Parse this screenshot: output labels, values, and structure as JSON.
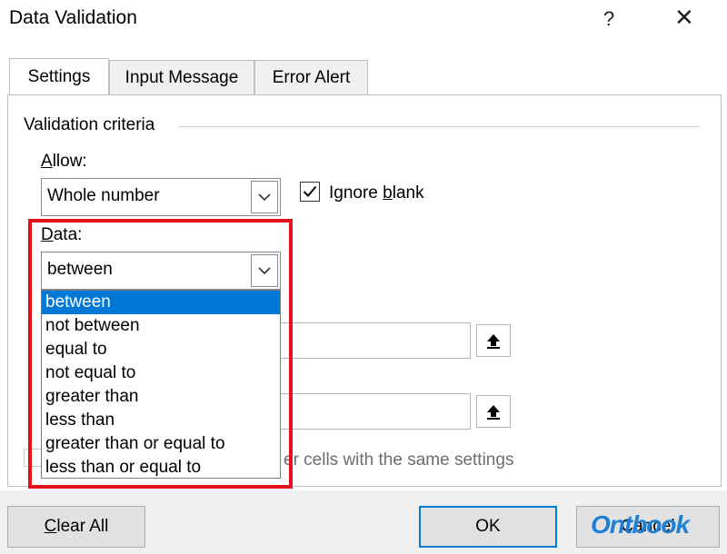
{
  "window": {
    "title": "Data Validation",
    "help_icon": "?",
    "close_icon": "✕"
  },
  "tabs": [
    {
      "label": "Settings",
      "active": true
    },
    {
      "label": "Input Message",
      "active": false
    },
    {
      "label": "Error Alert",
      "active": false
    }
  ],
  "settings": {
    "section_title": "Validation criteria",
    "allow_label_u": "A",
    "allow_label_rest": "llow:",
    "allow_value": "Whole number",
    "ignore_blank_pre": "Ignore ",
    "ignore_blank_u": "b",
    "ignore_blank_post": "lank",
    "ignore_blank_checked": true,
    "data_label_u": "D",
    "data_label_rest": "ata:",
    "data_value": "between",
    "data_options": [
      "between",
      "not between",
      "equal to",
      "not equal to",
      "greater than",
      "less than",
      "greater than or equal to",
      "less than or equal to"
    ],
    "selected_option_index": 0,
    "apply_text_partial": "er cells with the same settings"
  },
  "footer": {
    "clear_all_u": "C",
    "clear_all_rest": "lear All",
    "ok_label": "OK",
    "cancel_label": "Cancel"
  },
  "watermark": {
    "text": "Ontbook"
  },
  "colors": {
    "accent": "#0078d7",
    "highlight_border": "#e4101a"
  }
}
